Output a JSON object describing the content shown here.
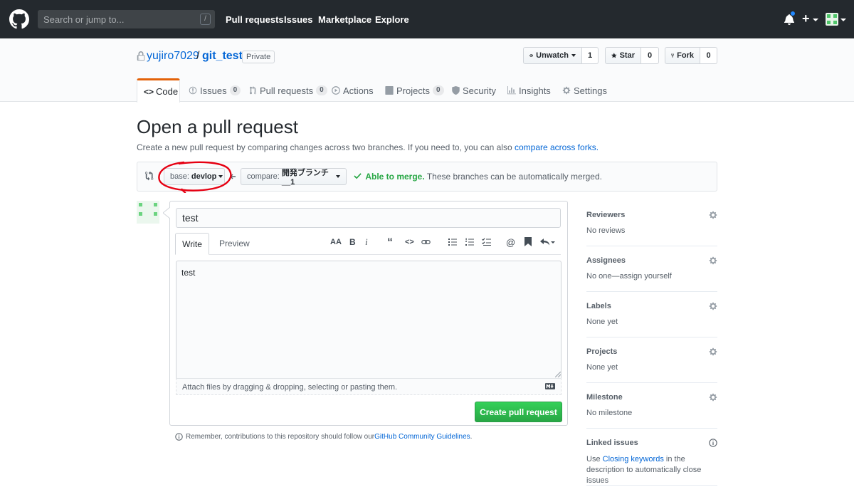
{
  "header": {
    "search_placeholder": "Search or jump to...",
    "search_hotkey": "/",
    "nav": [
      "Pull requests",
      "Issues",
      "Marketplace",
      "Explore"
    ],
    "plus_label": "+"
  },
  "repo": {
    "owner": "yujiro7029",
    "separator": "/",
    "name": "git_test",
    "visibility": "Private",
    "watch": {
      "label": "Unwatch",
      "count": "1"
    },
    "star": {
      "label": "Star",
      "count": "0"
    },
    "fork": {
      "label": "Fork",
      "count": "0"
    }
  },
  "tabs": [
    {
      "label": "Code"
    },
    {
      "label": "Issues",
      "count": "0"
    },
    {
      "label": "Pull requests",
      "count": "0"
    },
    {
      "label": "Actions"
    },
    {
      "label": "Projects",
      "count": "0"
    },
    {
      "label": "Security"
    },
    {
      "label": "Insights"
    },
    {
      "label": "Settings"
    }
  ],
  "page": {
    "title": "Open a pull request",
    "desc_prefix": "Create a new pull request by comparing changes across two branches. If you need to, you can also ",
    "desc_link": "compare across forks.",
    "base_label": "base:",
    "base_value": "devlop",
    "compare_label": "compare:",
    "compare_value": "開発ブランチ__1",
    "merge_status": "Able to merge.",
    "merge_text": "These branches can be automatically merged."
  },
  "compose": {
    "title_value": "test",
    "write_tab": "Write",
    "preview_tab": "Preview",
    "toolbar": {
      "heading": "AA",
      "bold": "B",
      "italic": "i",
      "quote": "“",
      "code": "<>"
    },
    "body_value": "test",
    "attach_text": "Attach files by dragging & dropping, selecting or pasting them.",
    "submit_label": "Create pull request",
    "remember_prefix": "Remember, contributions to this repository should follow our ",
    "remember_link": "GitHub Community Guidelines",
    "remember_suffix": "."
  },
  "sidebar": {
    "reviewers": {
      "title": "Reviewers",
      "value": "No reviews"
    },
    "assignees": {
      "title": "Assignees",
      "value": "No one—assign yourself"
    },
    "labels": {
      "title": "Labels",
      "value": "None yet"
    },
    "projects": {
      "title": "Projects",
      "value": "None yet"
    },
    "milestone": {
      "title": "Milestone",
      "value": "No milestone"
    },
    "linked": {
      "title": "Linked issues",
      "prefix": "Use ",
      "link": "Closing keywords",
      "suffix": " in the description to automatically close issues"
    }
  },
  "colors": {
    "header_bg": "#24292e",
    "link": "#0366d6",
    "success": "#28a745",
    "tab_accent": "#e36209",
    "annotation_red": "#e60012"
  }
}
